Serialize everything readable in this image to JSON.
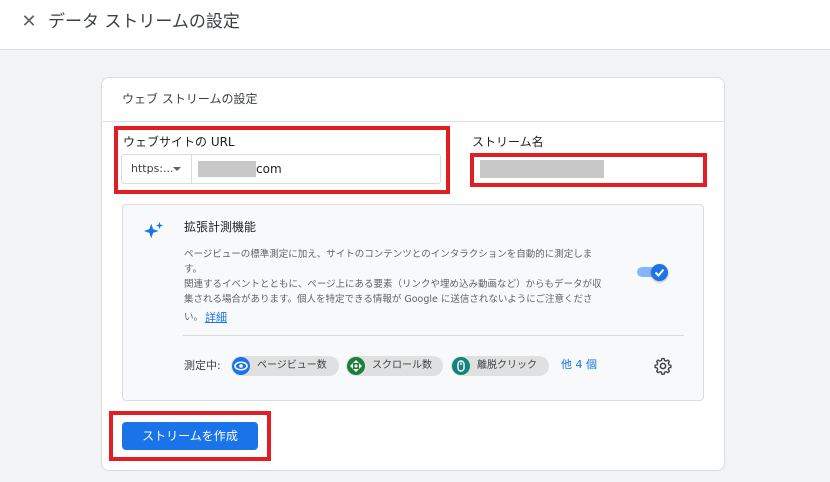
{
  "header": {
    "close_icon": "close-icon",
    "title": "データ ストリームの設定"
  },
  "card": {
    "title": "ウェブ ストリームの設定",
    "url_field": {
      "label": "ウェブサイトの URL",
      "protocol": "https:...",
      "value_suffix": "com"
    },
    "stream_name_field": {
      "label": "ストリーム名"
    },
    "enhanced": {
      "icon": "sparkle-icon",
      "title": "拡張計測機能",
      "description_lines": [
        "ページビューの標準測定に加え、サイトのコンテンツとのインタラクションを自動的に測定しま",
        "す。",
        "関連するイベントとともに、ページ上にある要素（リンクや埋め込み動画など）からもデータが収",
        "集される場合があります。個人を特定できる情報が Google に送信されないようにご注意くださ",
        "い。"
      ],
      "link": "詳細",
      "toggle_on": true,
      "measuring_label": "測定中:",
      "chips": [
        {
          "label": "ページビュー数",
          "icon": "eye-icon",
          "color": "#1a73e8"
        },
        {
          "label": "スクロール数",
          "icon": "crosshair-icon",
          "color": "#188038"
        },
        {
          "label": "離脱クリック",
          "icon": "mouse-icon",
          "color": "#12857a"
        }
      ],
      "others": "他 4 個",
      "settings_icon": "gear-icon"
    },
    "create_button": "ストリームを作成"
  },
  "colors": {
    "accent": "#1a73e8",
    "highlight": "#e01e24"
  }
}
